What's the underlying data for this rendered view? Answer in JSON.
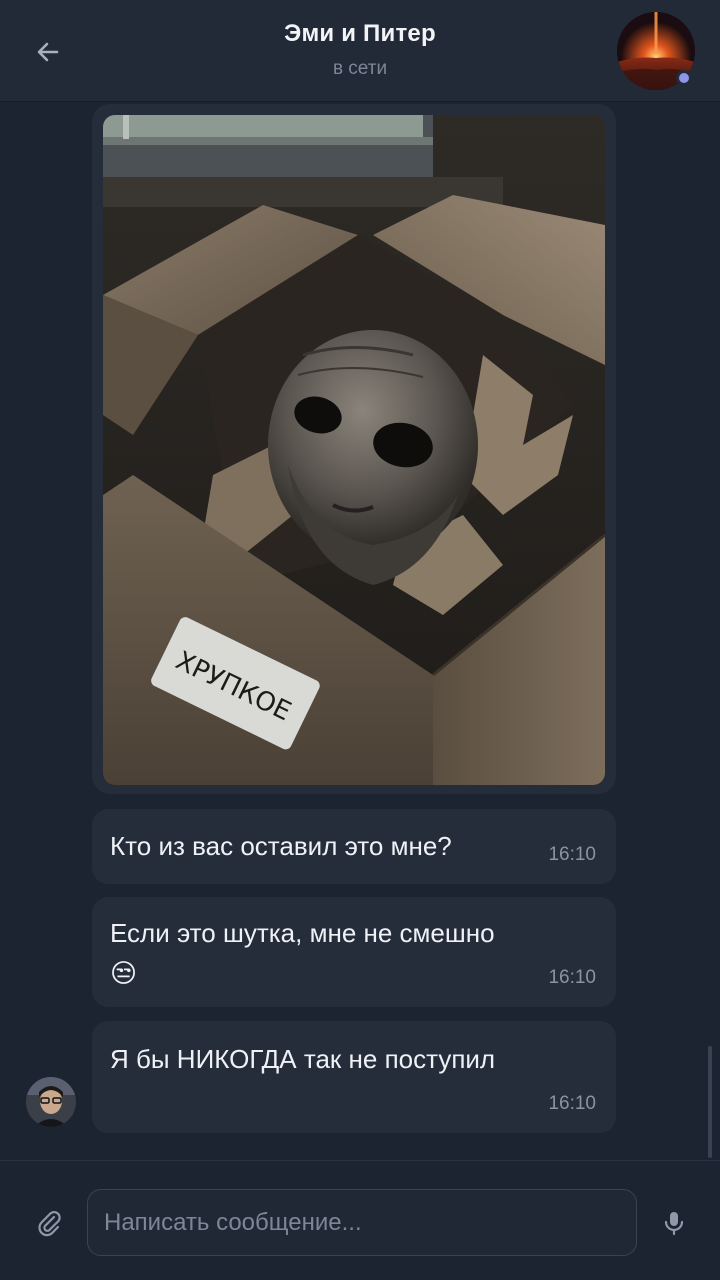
{
  "header": {
    "title": "Эми и Питер",
    "status": "в сети",
    "back_icon": "arrow-left-icon",
    "avatar_icon": "group-avatar",
    "online_color": "#8f95e8"
  },
  "photo_message": {
    "label_text": "ХРУПКОЕ"
  },
  "messages": [
    {
      "text": "Кто из вас оставил это мне?",
      "time": "16:10"
    },
    {
      "text": "Если это шутка, мне не смешно",
      "emoji": "😒",
      "time": "16:10"
    },
    {
      "text": "Я бы НИКОГДА так не поступил",
      "time": "16:10"
    }
  ],
  "composer": {
    "placeholder": "Написать сообщение...",
    "attach_icon": "paperclip-icon",
    "mic_icon": "microphone-icon"
  },
  "colors": {
    "background": "#1c2331",
    "bubble": "#252d3b",
    "header": "#222a38"
  }
}
